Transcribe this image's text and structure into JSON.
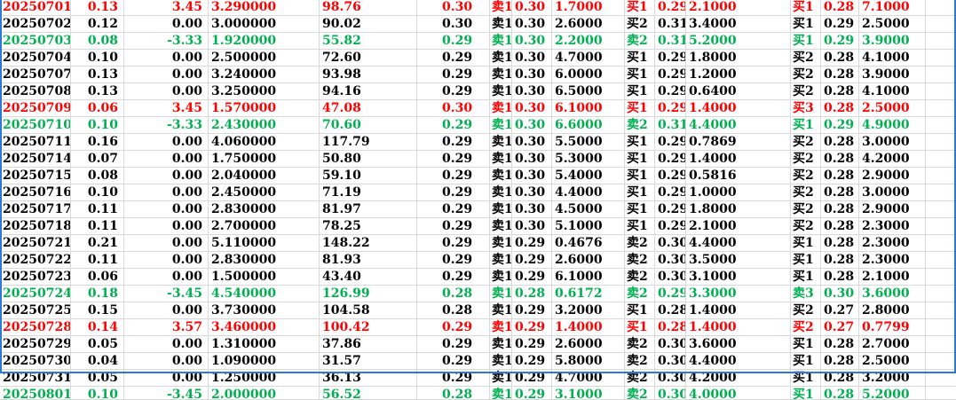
{
  "colors": {
    "up": "#ff0000",
    "down": "#00b050",
    "flat": "#000000",
    "grid": "#d9d9d9",
    "frame": "#2b79d8"
  },
  "rows": [
    {
      "tone": "up",
      "cells": [
        "20250701",
        "0.13",
        "3.45",
        "3.290000",
        "98.76",
        "0.30",
        "卖1",
        "0.30",
        "1.7000",
        "买1",
        "0.29",
        "2.1000",
        "买1",
        "0.28",
        "7.1000"
      ]
    },
    {
      "tone": "flat",
      "cells": [
        "20250702",
        "0.12",
        "0.00",
        "3.000000",
        "90.02",
        "0.30",
        "卖1",
        "0.30",
        "2.6000",
        "买2",
        "0.31",
        "3.4000",
        "买1",
        "0.29",
        "2.5000"
      ]
    },
    {
      "tone": "down",
      "cells": [
        "20250703",
        "0.08",
        "-3.33",
        "1.920000",
        "55.82",
        "0.29",
        "卖1",
        "0.30",
        "2.2000",
        "卖2",
        "0.31",
        "5.2000",
        "买1",
        "0.29",
        "3.9000"
      ]
    },
    {
      "tone": "flat",
      "cells": [
        "20250704",
        "0.10",
        "0.00",
        "2.500000",
        "72.60",
        "0.29",
        "卖1",
        "0.30",
        "4.7000",
        "买1",
        "0.29",
        "1.8000",
        "买2",
        "0.28",
        "4.1000"
      ]
    },
    {
      "tone": "flat",
      "cells": [
        "20250707",
        "0.13",
        "0.00",
        "3.240000",
        "93.98",
        "0.29",
        "卖1",
        "0.30",
        "6.0000",
        "买1",
        "0.29",
        "1.2000",
        "买2",
        "0.28",
        "3.9000"
      ]
    },
    {
      "tone": "flat",
      "cells": [
        "20250708",
        "0.13",
        "0.00",
        "3.250000",
        "94.16",
        "0.29",
        "卖1",
        "0.30",
        "6.5000",
        "买1",
        "0.29",
        "0.6400",
        "买2",
        "0.28",
        "4.1000"
      ]
    },
    {
      "tone": "up",
      "cells": [
        "20250709",
        "0.06",
        "3.45",
        "1.570000",
        "47.08",
        "0.30",
        "卖1",
        "0.30",
        "6.1000",
        "买1",
        "0.29",
        "1.4000",
        "买3",
        "0.28",
        "2.5000"
      ]
    },
    {
      "tone": "down",
      "cells": [
        "20250710",
        "0.10",
        "-3.33",
        "2.430000",
        "70.60",
        "0.29",
        "卖1",
        "0.30",
        "6.6000",
        "卖2",
        "0.31",
        "4.4000",
        "买1",
        "0.29",
        "4.9000"
      ]
    },
    {
      "tone": "flat",
      "cells": [
        "20250711",
        "0.16",
        "0.00",
        "4.060000",
        "117.79",
        "0.29",
        "卖1",
        "0.30",
        "5.5000",
        "买1",
        "0.29",
        "0.7869",
        "买2",
        "0.28",
        "3.0000"
      ]
    },
    {
      "tone": "flat",
      "cells": [
        "20250714",
        "0.07",
        "0.00",
        "1.750000",
        "50.80",
        "0.29",
        "卖1",
        "0.30",
        "5.3000",
        "买1",
        "0.29",
        "1.4000",
        "买2",
        "0.28",
        "4.2000"
      ]
    },
    {
      "tone": "flat",
      "cells": [
        "20250715",
        "0.08",
        "0.00",
        "2.040000",
        "59.10",
        "0.29",
        "卖1",
        "0.30",
        "5.4000",
        "买1",
        "0.29",
        "0.5816",
        "买2",
        "0.28",
        "2.9000"
      ]
    },
    {
      "tone": "flat",
      "cells": [
        "20250716",
        "0.10",
        "0.00",
        "2.450000",
        "71.19",
        "0.29",
        "卖1",
        "0.30",
        "4.4000",
        "买1",
        "0.29",
        "1.0000",
        "买2",
        "0.28",
        "3.0000"
      ]
    },
    {
      "tone": "flat",
      "cells": [
        "20250717",
        "0.11",
        "0.00",
        "2.830000",
        "81.97",
        "0.29",
        "卖1",
        "0.30",
        "4.5000",
        "买1",
        "0.29",
        "1.8000",
        "买2",
        "0.28",
        "2.9000"
      ]
    },
    {
      "tone": "flat",
      "cells": [
        "20250718",
        "0.11",
        "0.00",
        "2.700000",
        "78.25",
        "0.29",
        "卖1",
        "0.30",
        "5.1000",
        "买1",
        "0.29",
        "2.1000",
        "买2",
        "0.28",
        "2.3000"
      ]
    },
    {
      "tone": "flat",
      "cells": [
        "20250721",
        "0.21",
        "0.00",
        "5.110000",
        "148.22",
        "0.29",
        "卖1",
        "0.29",
        "0.4676",
        "卖2",
        "0.30",
        "4.4000",
        "买1",
        "0.28",
        "2.3000"
      ]
    },
    {
      "tone": "flat",
      "cells": [
        "20250722",
        "0.11",
        "0.00",
        "2.830000",
        "81.93",
        "0.29",
        "卖1",
        "0.29",
        "2.6000",
        "卖2",
        "0.30",
        "3.5000",
        "买1",
        "0.28",
        "2.3000"
      ]
    },
    {
      "tone": "flat",
      "cells": [
        "20250723",
        "0.06",
        "0.00",
        "1.500000",
        "43.40",
        "0.29",
        "卖1",
        "0.29",
        "6.1000",
        "卖2",
        "0.30",
        "3.1000",
        "买1",
        "0.28",
        "2.1000"
      ]
    },
    {
      "tone": "down",
      "cells": [
        "20250724",
        "0.18",
        "-3.45",
        "4.540000",
        "126.99",
        "0.28",
        "卖1",
        "0.28",
        "0.6172",
        "卖2",
        "0.29",
        "3.3000",
        "卖3",
        "0.30",
        "3.6000"
      ]
    },
    {
      "tone": "flat",
      "cells": [
        "20250725",
        "0.15",
        "0.00",
        "3.730000",
        "104.58",
        "0.28",
        "卖1",
        "0.29",
        "3.2000",
        "买1",
        "0.28",
        "1.4000",
        "买2",
        "0.27",
        "2.8000"
      ]
    },
    {
      "tone": "up",
      "cells": [
        "20250728",
        "0.14",
        "3.57",
        "3.460000",
        "100.42",
        "0.29",
        "卖1",
        "0.29",
        "1.4000",
        "买1",
        "0.28",
        "1.4000",
        "买2",
        "0.27",
        "0.7799"
      ]
    },
    {
      "tone": "flat",
      "cells": [
        "20250729",
        "0.05",
        "0.00",
        "1.310000",
        "37.86",
        "0.29",
        "卖1",
        "0.29",
        "2.6000",
        "卖2",
        "0.30",
        "3.6000",
        "买1",
        "0.28",
        "2.7000"
      ]
    },
    {
      "tone": "flat",
      "cells": [
        "20250730",
        "0.04",
        "0.00",
        "1.090000",
        "31.57",
        "0.29",
        "卖1",
        "0.29",
        "5.8000",
        "卖2",
        "0.30",
        "4.4000",
        "买1",
        "0.28",
        "2.5000"
      ]
    },
    {
      "tone": "flat",
      "cells": [
        "20250731",
        "0.05",
        "0.00",
        "1.250000",
        "36.13",
        "0.29",
        "卖1",
        "0.29",
        "4.7000",
        "卖2",
        "0.30",
        "4.2000",
        "买1",
        "0.28",
        "3.2000"
      ]
    },
    {
      "tone": "down",
      "cells": [
        "20250801",
        "0.10",
        "-3.45",
        "2.000000",
        "56.52",
        "0.28",
        "卖1",
        "0.29",
        "3.1000",
        "卖2",
        "0.30",
        "4.0000",
        "买1",
        "0.28",
        "5.2000"
      ]
    }
  ]
}
